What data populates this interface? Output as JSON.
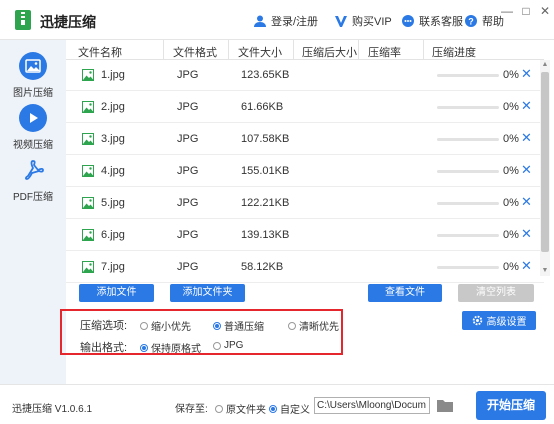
{
  "app": {
    "title": "迅捷压缩",
    "version": "迅捷压缩 V1.0.6.1"
  },
  "titlebar": {
    "login": "登录/注册",
    "vip": "购买VIP",
    "service": "联系客服",
    "help": "帮助"
  },
  "sidebar": {
    "items": [
      {
        "label": "图片压缩",
        "icon": "image-icon"
      },
      {
        "label": "视频压缩",
        "icon": "play-icon"
      },
      {
        "label": "PDF压缩",
        "icon": "pdf-icon"
      }
    ]
  },
  "table": {
    "headers": [
      "文件名称",
      "文件格式",
      "文件大小",
      "压缩后大小",
      "压缩率",
      "压缩进度"
    ],
    "rows": [
      {
        "name": "1.jpg",
        "format": "JPG",
        "size": "123.65KB",
        "progress": "0%"
      },
      {
        "name": "2.jpg",
        "format": "JPG",
        "size": "61.66KB",
        "progress": "0%"
      },
      {
        "name": "3.jpg",
        "format": "JPG",
        "size": "107.58KB",
        "progress": "0%"
      },
      {
        "name": "4.jpg",
        "format": "JPG",
        "size": "155.01KB",
        "progress": "0%"
      },
      {
        "name": "5.jpg",
        "format": "JPG",
        "size": "122.21KB",
        "progress": "0%"
      },
      {
        "name": "6.jpg",
        "format": "JPG",
        "size": "139.13KB",
        "progress": "0%"
      },
      {
        "name": "7.jpg",
        "format": "JPG",
        "size": "58.12KB",
        "progress": "0%"
      }
    ]
  },
  "actions": {
    "add_file": "添加文件",
    "add_folder": "添加文件夹",
    "view_files": "查看文件",
    "clear_list": "清空列表"
  },
  "options": {
    "compress_label": "压缩选项:",
    "compress_opts": [
      "缩小优先",
      "普通压缩",
      "清晰优先"
    ],
    "compress_selected": "普通压缩",
    "output_label": "输出格式:",
    "output_opts": [
      "保持原格式",
      "JPG"
    ],
    "output_selected": "保持原格式",
    "advanced": "高级设置"
  },
  "footer": {
    "save_to": "保存至:",
    "save_opts": [
      "原文件夹",
      "自定义"
    ],
    "save_selected": "自定义",
    "path": "C:\\Users\\Mloong\\Docum",
    "start": "开始压缩"
  },
  "colors": {
    "accent": "#2b79e5",
    "highlight_border": "#e5262d",
    "sidebar_bg": "#eef3f9"
  }
}
